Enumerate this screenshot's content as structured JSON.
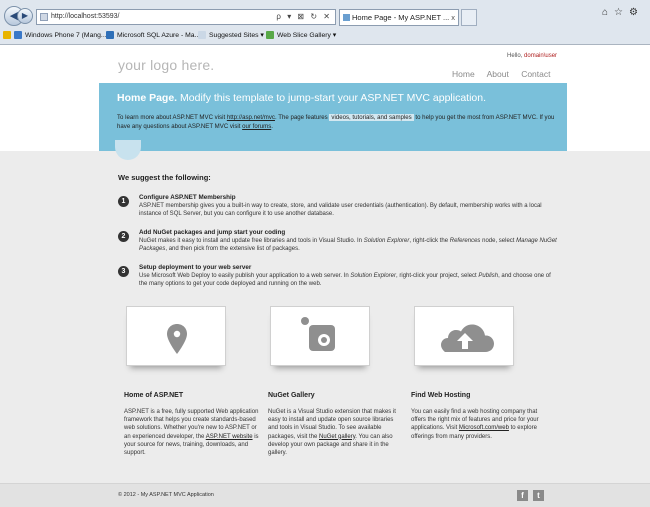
{
  "browser": {
    "address": "http://localhost:53593/",
    "address_tools": "ρ ▾ ⊠ ↻ ✕",
    "tab_title": "Home Page - My ASP.NET ...",
    "tab_close": "x",
    "favorites": [
      "Windows Phone 7 (Mang...",
      "Microsoft SQL Azure - Ma...",
      "Suggested Sites ▾",
      "Web Slice Gallery ▾"
    ]
  },
  "header": {
    "logo": "your logo here.",
    "hello": "Hello,",
    "user": "domain\\user",
    "menu": [
      "Home",
      "About",
      "Contact"
    ]
  },
  "featured": {
    "title_bold": "Home Page.",
    "title_rest": "Modify this template to jump-start your ASP.NET MVC application.",
    "p1": "To learn more about ASP.NET MVC visit",
    "link1": "http://asp.net/mvc",
    "p2": ". The page features",
    "link2": "videos, tutorials, and samples",
    "p3": "to help you get the most from ASP.NET MVC. If you have any questions about ASP.NET MVC visit",
    "link3": "our forums",
    "p4": "."
  },
  "suggest_heading": "We suggest the following:",
  "steps": [
    {
      "num": "1",
      "title": "Configure ASP.NET Membership",
      "body": "ASP.NET membership gives you a built-in way to create, store, and validate user credentials (authentication). By default, membership works with a local instance of SQL Server, but you can configure it to use another database."
    },
    {
      "num": "2",
      "title": "Add NuGet packages and jump start your coding",
      "body_a": "NuGet makes it easy to install and update free libraries and tools in Visual Studio. In ",
      "body_i1": "Solution Explorer",
      "body_b": ", right-click the ",
      "body_i2": "References",
      "body_c": " node, select ",
      "body_i3": "Manage NuGet Packages",
      "body_d": ", and then pick from the extensive list of packages."
    },
    {
      "num": "3",
      "title": "Setup deployment to your web server",
      "body_a": "Use Microsoft Web Deploy to easily publish your application to a web server. In ",
      "body_i1": "Solution Explorer",
      "body_b": ", right-click your project, select ",
      "body_i2": "Publish",
      "body_c": ", and choose one of the many options to get your code deployed and running on the web."
    }
  ],
  "cards": [
    {
      "title": "Home of ASP.NET",
      "a": "ASP.NET is a free, fully supported Web application framework that helps you create standards-based web solutions. Whether you're new to ASP.NET or an experienced developer, the ",
      "link": "ASP.NET website",
      "b": " is your source for news, training, downloads, and support."
    },
    {
      "title": "NuGet Gallery",
      "a": "NuGet is a Visual Studio extension that makes it easy to install and update open source libraries and tools in Visual Studio. To see available packages, visit the ",
      "link": "NuGet gallery",
      "b": ". You can also develop your own package and share it in the gallery."
    },
    {
      "title": "Find Web Hosting",
      "a": "You can easily find a web hosting company that offers the right mix of features and price for your applications. Visit ",
      "link": "Microsoft.com/web",
      "b": " to explore offerings from many providers."
    }
  ],
  "footer": {
    "copyright": "© 2012 - My ASP.NET MVC Application",
    "facebook": "f",
    "twitter": "t"
  },
  "colors": {
    "featured_bg": "#7ac0da",
    "login_user": "#b02020",
    "logo": "#b6b6b6"
  }
}
